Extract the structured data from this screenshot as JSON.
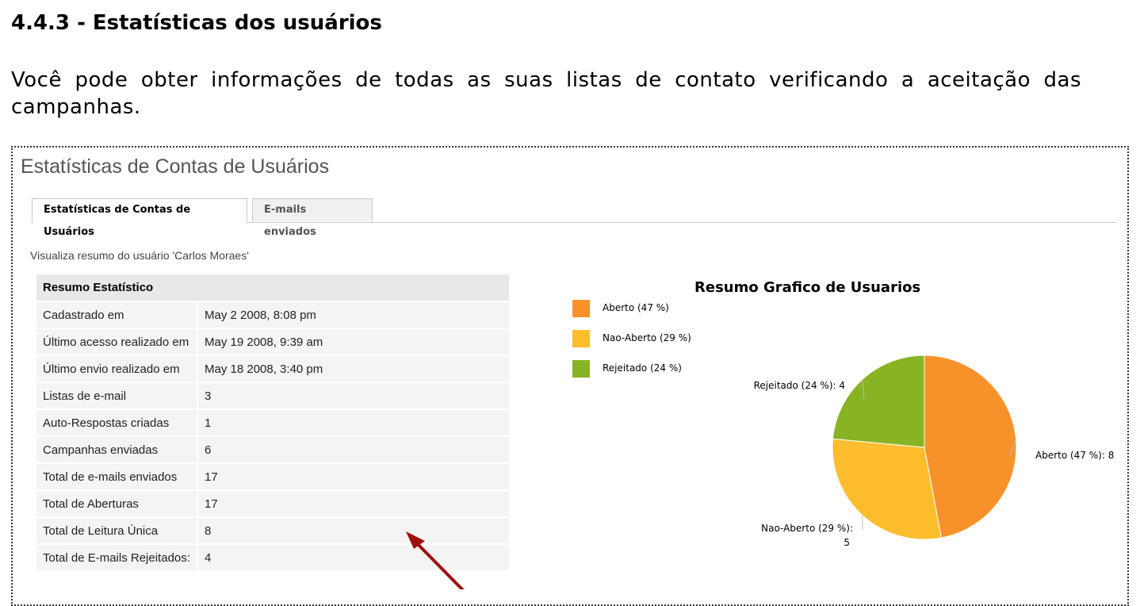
{
  "document": {
    "heading": "4.4.3 - Estatísticas dos usuários",
    "paragraph": "Você pode obter informações de todas as suas listas de contato verificando a aceitação das campanhas."
  },
  "app": {
    "title": "Estatísticas de Contas de Usuários",
    "tabs": [
      {
        "label": "Estatísticas de Contas de Usuários",
        "active": true
      },
      {
        "label": "E-mails enviados",
        "active": false
      }
    ],
    "summary_line": "Visualiza resumo do usuário 'Carlos Moraes'",
    "stats": {
      "header": "Resumo Estatístico",
      "rows": [
        {
          "label": "Cadastrado em",
          "value": "May 2 2008, 8:08 pm"
        },
        {
          "label": "Último acesso realizado em",
          "value": "May 19 2008, 9:39 am"
        },
        {
          "label": "Último envio realizado em",
          "value": "May 18 2008, 3:40 pm"
        },
        {
          "label": "Listas de e-mail",
          "value": "3"
        },
        {
          "label": "Auto-Respostas criadas",
          "value": "1"
        },
        {
          "label": "Campanhas enviadas",
          "value": "6"
        },
        {
          "label": "Total de e-mails enviados",
          "value": "17"
        },
        {
          "label": "Total de Aberturas",
          "value": "17"
        },
        {
          "label": "Total de Leitura Única",
          "value": "8"
        },
        {
          "label": "Total de E-mails Rejeitados:",
          "value": "4"
        }
      ]
    }
  },
  "chart_data": {
    "type": "pie",
    "title": "Resumo Grafico de Usuarios",
    "slices": [
      {
        "name": "Aberto (47 %)",
        "value": 8,
        "color": "#f7922b",
        "slice_label": "Aberto (47 %): 8"
      },
      {
        "name": "Nao-Aberto (29 %)",
        "value": 5,
        "color": "#fdbd2c",
        "slice_label": "Nao-Aberto (29 %): 5"
      },
      {
        "name": "Rejeitado (24 %)",
        "value": 4,
        "color": "#88b322",
        "slice_label": "Rejeitado (24 %): 4"
      }
    ],
    "legend_position": "top-left"
  },
  "annotation": {
    "arrow_color": "#a01010"
  }
}
